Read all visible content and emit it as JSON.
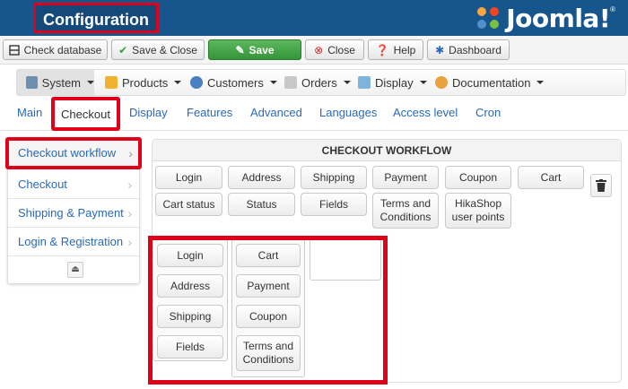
{
  "header": {
    "title": "Configuration",
    "logo_text": "Joomla!",
    "logo_reg": "®"
  },
  "toolbar": {
    "check_database": "Check database",
    "save_close": "Save & Close",
    "save": "Save",
    "close": "Close",
    "help": "Help",
    "dashboard": "Dashboard"
  },
  "menu": {
    "system": "System",
    "products": "Products",
    "customers": "Customers",
    "orders": "Orders",
    "display": "Display",
    "documentation": "Documentation"
  },
  "tabs": [
    "Main",
    "Checkout",
    "Display",
    "Features",
    "Advanced",
    "Languages",
    "Access level",
    "Cron"
  ],
  "sidenav": [
    "Checkout workflow",
    "Checkout",
    "Shipping & Payment",
    "Login & Registration"
  ],
  "workflow": {
    "title": "CHECKOUT WORKFLOW",
    "available": [
      "Login",
      "Address",
      "Shipping",
      "Payment",
      "Coupon",
      "Cart",
      "Cart status",
      "Status",
      "Fields",
      "Terms and Conditions",
      "HikaShop user points"
    ],
    "step1": [
      "Login",
      "Address",
      "Shipping",
      "Fields"
    ],
    "step2": [
      "Cart",
      "Payment",
      "Coupon",
      "Terms and Conditions"
    ]
  }
}
